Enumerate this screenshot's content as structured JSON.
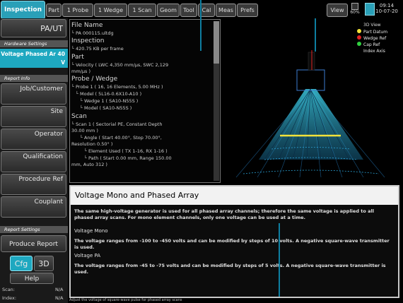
{
  "tabs": [
    {
      "label": "Inspection",
      "active": true
    },
    {
      "label": "Part"
    },
    {
      "label": "1 Probe"
    },
    {
      "label": "1 Wedge"
    },
    {
      "label": "1 Scan"
    },
    {
      "label": "Geom"
    },
    {
      "label": "Tool"
    },
    {
      "label": "Cal"
    },
    {
      "label": "Meas"
    },
    {
      "label": "Prefs"
    }
  ],
  "top_right": {
    "view_label": "View",
    "disk_label": "60%",
    "time": "09:14",
    "date": "10-07-20"
  },
  "left": {
    "paut_label": "PA/UT",
    "hardware_header": "Hardware Settings",
    "voltage_selected": "Voltage Phased Ar 40 V",
    "report_header": "Report Info",
    "buttons": [
      "Job/Customer",
      "Site",
      "Operator",
      "Qualification",
      "Procedure Ref",
      "Couplant"
    ],
    "report_settings_header": "Report Settings",
    "produce_report": "Produce Report",
    "cfg_label": "Cfg",
    "three_d_label": "3D",
    "help_label": "Help",
    "scan_label": "Scan:",
    "scan_value": "N/A",
    "index_label": "Index:",
    "index_value": "N/A"
  },
  "info": {
    "file_name_h": "File Name",
    "file_name_v": "└ PA 000115.ultdg",
    "inspection_h": "Inspection",
    "inspection_v": "└ 420.75 KB per frame",
    "part_h": "Part",
    "part_v1": "└ Velocity ( LWC 4,350 mm/µs, SWC 2,129",
    "part_v2": "mm/µs )",
    "probe_h": "Probe / Wedge",
    "probe_v1": "└ Probe 1 ( 16, 16 Elements, 5.00 MHz )",
    "probe_v2": "└ Model ( 5L16-0.6X10-A10 )",
    "probe_v3": "└ Wedge 1 ( SA10-N55S )",
    "probe_v4": "└ Model ( SA10-N55S )",
    "scan_h": "Scan",
    "scan_v1": "└ Scan 1 ( Sectorial PE, Constant Depth",
    "scan_v2": "30.00 mm )",
    "scan_v3": "└ Angle ( Start 40.00°, Stop 70.00°,",
    "scan_v4": "Resolution 0.50° )",
    "scan_v5": "└ Element Used ( TX 1-16, RX 1-16 )",
    "scan_v6": "└ Path ( Start 0.00 mm, Range 150.00",
    "scan_v7": "mm, Auto 312 )"
  },
  "view": {
    "title": "3D View",
    "legend": [
      {
        "label": "Part Datum",
        "color": "#f2e23a"
      },
      {
        "label": "Wedge Ref",
        "color": "#e02020"
      },
      {
        "label": "Cap Ref",
        "color": "#30d040"
      },
      {
        "label": "Index Axis",
        "color": "#000000"
      }
    ]
  },
  "help": {
    "title": "Voltage Mono and Phased Array",
    "p1": "The same high-voltage generator is used for all phased array channels; therefore the same voltage is applied to all phased array scans. For mono element channels, only one voltage can be used at a time.",
    "label1": "Voltage Mono",
    "p2": "The voltage ranges from -100 to -450 volts and can be modified by steps of 10 volts. A negative square-wave transmitter is used.",
    "label2": "Voltage PA",
    "p3": "The voltage ranges from -45 to -75 volts and can be modified by steps of 5 volts. A negative square-wave transmitter is used."
  },
  "status_bar": "Adjust the voltage of square-wave pulse for phased array scans"
}
